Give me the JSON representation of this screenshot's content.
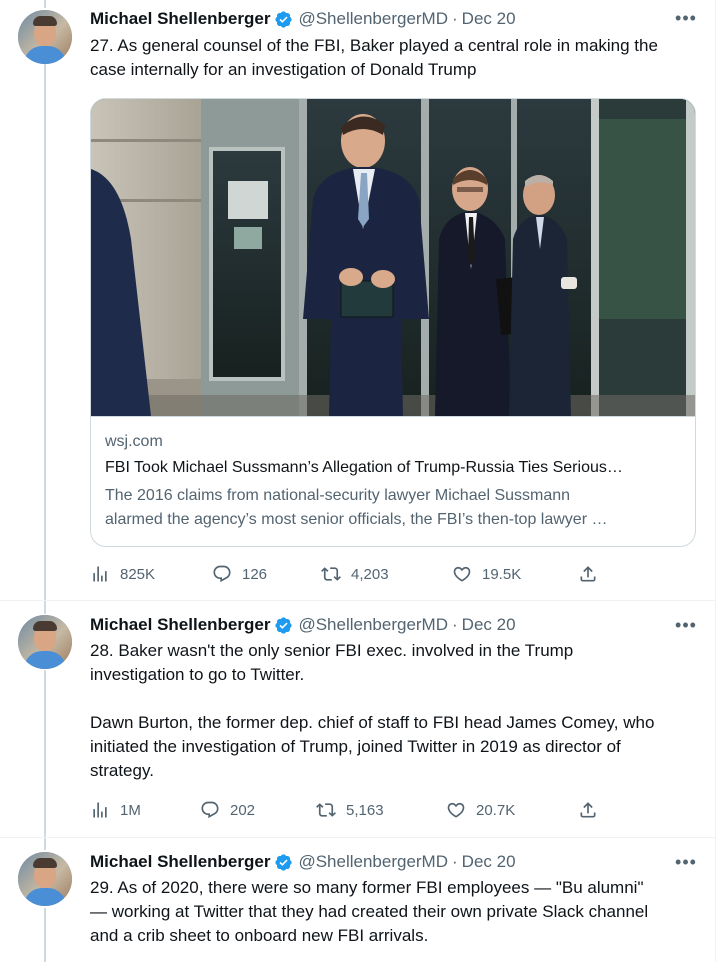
{
  "tweets": [
    {
      "author_name": "Michael Shellenberger",
      "handle": "@ShellenbergerMD",
      "separator": "·",
      "date": "Dec 20",
      "more_icon": "more-icon",
      "text_lines": [
        "27. As general counsel of the FBI, Baker played a central role in making the",
        "case internally for an investigation of Donald Trump"
      ],
      "card": {
        "domain": "wsj.com",
        "title": "FBI Took Michael Sussmann’s Allegation of Trump-Russia Ties Serious…",
        "description_lines": [
          "The 2016 claims from national-security lawyer Michael Sussmann",
          "alarmed the agency’s most senior officials, the FBI’s then-top lawyer …"
        ]
      },
      "stats": {
        "views": "825K",
        "replies": "126",
        "retweets": "4,203",
        "likes": "19.5K"
      }
    },
    {
      "author_name": "Michael Shellenberger",
      "handle": "@ShellenbergerMD",
      "separator": "·",
      "date": "Dec 20",
      "text_lines": [
        "28. Baker wasn't the only senior FBI exec. involved in the Trump",
        "investigation to go to Twitter."
      ],
      "text_lines_2": [
        "Dawn Burton, the former dep. chief of staff to FBI head James Comey, who",
        "initiated the investigation of Trump, joined Twitter in 2019 as director of",
        "strategy."
      ],
      "stats": {
        "views": "1M",
        "replies": "202",
        "retweets": "5,163",
        "likes": "20.7K"
      }
    },
    {
      "author_name": "Michael Shellenberger",
      "handle": "@ShellenbergerMD",
      "separator": "·",
      "date": "Dec 20",
      "text_lines": [
        "29. As of 2020, there were so many former FBI employees — \"Bu alumni\"",
        "— working at Twitter that they had created their own private Slack channel",
        "and a crib sheet to onboard new FBI arrivals."
      ]
    }
  ],
  "icons": {
    "views": "analytics-icon",
    "reply": "reply-icon",
    "retweet": "retweet-icon",
    "like": "heart-icon",
    "share": "share-icon",
    "verified": "verified-badge-icon"
  },
  "colors": {
    "text": "#0f1419",
    "secondary": "#536471",
    "verified": "#1d9bf0",
    "border": "#cfd9de",
    "thread_line": "#cfd9de"
  }
}
